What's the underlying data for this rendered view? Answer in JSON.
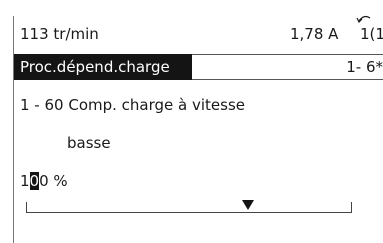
{
  "status": {
    "speed": "113 tr/min",
    "current": "1,78 A",
    "setup": "1(1"
  },
  "title_bar": {
    "group_name": "Proc.dépend.charge",
    "group_index": "1- 6*"
  },
  "parameter": {
    "name_line1": "1 - 60 Comp. charge à vitesse",
    "name_line2": "basse"
  },
  "value": {
    "digit_before_cursor": "1",
    "digit_at_cursor": "0",
    "digits_after_cursor": "0 %"
  },
  "slider": {
    "level_fraction": 0.68
  },
  "colors": {
    "background": "#ffffff",
    "text": "#1a1a1a",
    "inverse_bg": "#141414",
    "inverse_text": "#ffffff"
  },
  "icons": {
    "back": "back-arrow-icon"
  }
}
